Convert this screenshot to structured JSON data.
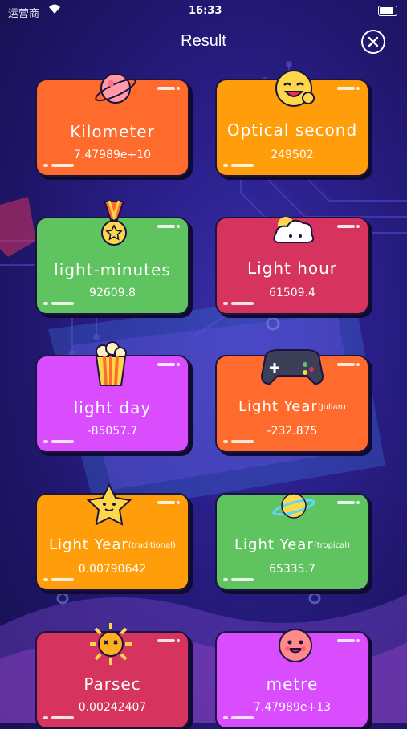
{
  "status_bar": {
    "carrier": "运营商",
    "time": "16:33"
  },
  "header": {
    "title": "Result"
  },
  "cards": [
    {
      "title": "Kilometer",
      "suffix": "",
      "value": "7.47989e+10",
      "color": "#ff6a2d",
      "icon": "planet-icon"
    },
    {
      "title": "Optical second",
      "suffix": "",
      "value": "249502",
      "color": "#ff9d0a",
      "icon": "laughing-face-icon"
    },
    {
      "title": "light-minutes",
      "suffix": "",
      "value": "92609.8",
      "color": "#5fc45f",
      "icon": "medal-icon"
    },
    {
      "title": "Light hour",
      "suffix": "",
      "value": "61509.4",
      "color": "#d6335f",
      "icon": "cloud-sun-icon"
    },
    {
      "title": "light day",
      "suffix": "",
      "value": "-85057.7",
      "color": "#d94dff",
      "icon": "popcorn-icon"
    },
    {
      "title": "Light Year",
      "suffix": "(Julian)",
      "value": "-232.875",
      "color": "#ff6a2d",
      "icon": "gamepad-icon"
    },
    {
      "title": "Light Year",
      "suffix": "(traditional)",
      "value": "0.00790642",
      "color": "#ff9d0a",
      "icon": "star-icon"
    },
    {
      "title": "Light Year",
      "suffix": "(tropical)",
      "value": "65335.7",
      "color": "#5fc45f",
      "icon": "ringed-planet-icon"
    },
    {
      "title": "Parsec",
      "suffix": "",
      "value": "0.00242407",
      "color": "#d6335f",
      "icon": "sun-icon"
    },
    {
      "title": "metre",
      "suffix": "",
      "value": "7.47989e+13",
      "color": "#d94dff",
      "icon": "smiley-face-icon"
    }
  ]
}
